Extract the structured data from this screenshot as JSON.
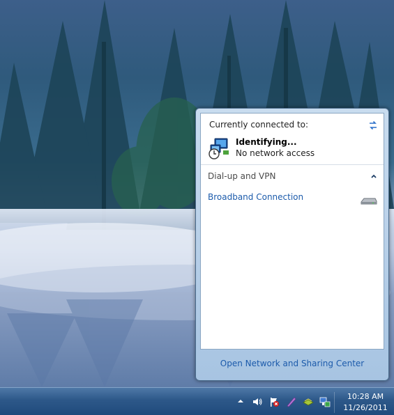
{
  "flyout": {
    "currently_connected_label": "Currently connected to:",
    "network_status": "Identifying...",
    "network_access": "No network access",
    "section_header": "Dial-up and VPN",
    "connection_name": "Broadband Connection",
    "footer_link": "Open Network and Sharing Center"
  },
  "taskbar": {
    "clock_time": "10:28 AM",
    "clock_date": "11/26/2011",
    "tray_icons": [
      "show-hidden-icons-arrow",
      "volume-icon",
      "action-center-flag-icon",
      "pen-icon",
      "layers-icon",
      "network-icon"
    ]
  },
  "colors": {
    "link": "#1c5bab",
    "taskbar": "#2d5889",
    "flyout_border": "#a7c4e2"
  }
}
